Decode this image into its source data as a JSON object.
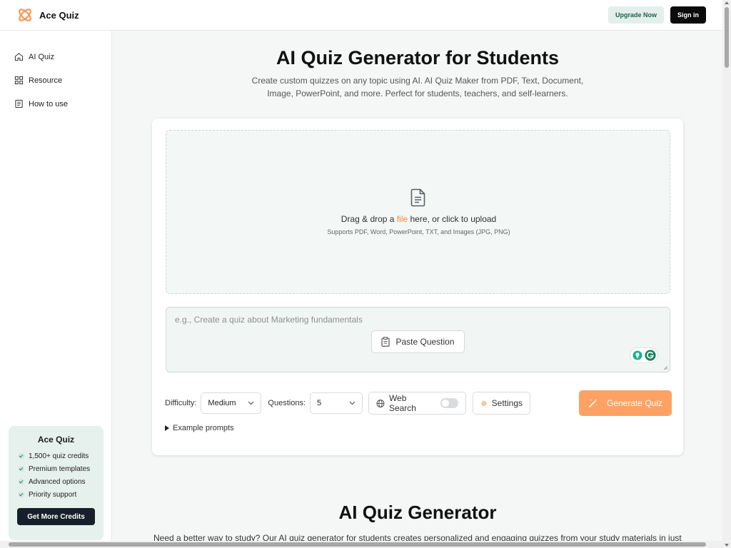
{
  "header": {
    "logo_name": "Ace Quiz",
    "upgrade_label": "Upgrade Now",
    "signin_label": "Sign in"
  },
  "sidebar": {
    "items": [
      {
        "label": "AI Quiz",
        "icon": "home-icon"
      },
      {
        "label": "Resource",
        "icon": "grid-icon"
      },
      {
        "label": "How to use",
        "icon": "book-icon"
      }
    ],
    "promo": {
      "title": "Ace Quiz",
      "features": [
        "1,500+ quiz credits",
        "Premium templates",
        "Advanced options",
        "Priority support"
      ],
      "button_label": "Get More Credits"
    }
  },
  "hero": {
    "title": "AI Quiz Generator for Students",
    "subtitle": "Create custom quizzes on any topic using AI. AI Quiz Maker from PDF, Text, Document, Image, PowerPoint, and more. Perfect for students, teachers, and self-learners."
  },
  "upload": {
    "text_before": "Drag & drop a ",
    "text_highlight": "file",
    "text_after": " here, or click to upload",
    "supported": "Supports PDF, Word, PowerPoint, TXT, and Images (JPG, PNG)"
  },
  "prompt": {
    "placeholder": "e.g., Create a quiz about Marketing fundamentals",
    "paste_label": "Paste Question"
  },
  "controls": {
    "difficulty_label": "Difficulty:",
    "difficulty_value": "Medium",
    "questions_label": "Questions:",
    "questions_value": "5",
    "web_search_label": "Web Search",
    "web_search_enabled": false,
    "settings_label": "Settings",
    "generate_label": "Generate Quiz"
  },
  "examples_label": "Example prompts",
  "section": {
    "title": "AI Quiz Generator",
    "text": "Need a better way to study? Our AI quiz generator for students creates personalized and engaging quizzes from your study materials in just"
  },
  "colors": {
    "accent": "#f08a3c",
    "generate_bg": "#fda263",
    "promo_bg": "#e6f0ec"
  }
}
